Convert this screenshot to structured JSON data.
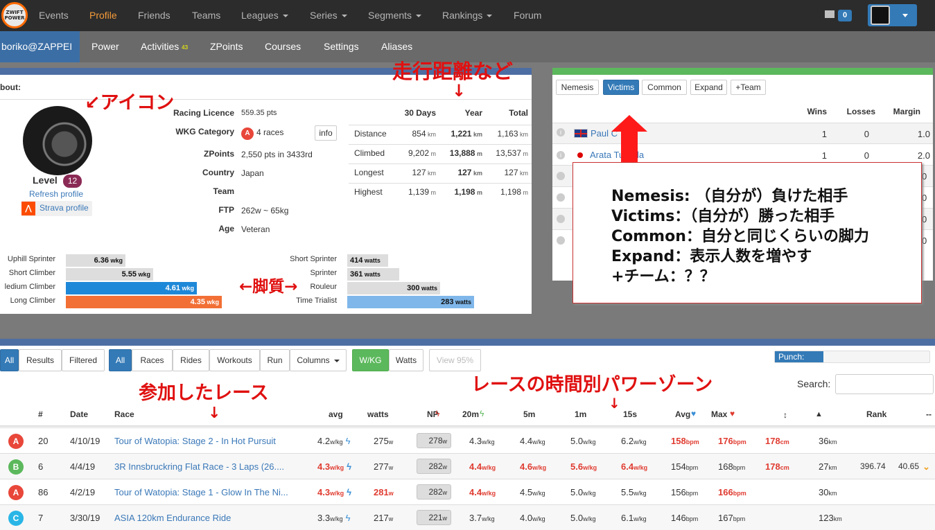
{
  "topnav": {
    "logo": "ZWIFT POWER",
    "items": [
      "Events",
      "Profile",
      "Friends",
      "Teams",
      "Leagues",
      "Series",
      "Segments",
      "Rankings",
      "Forum"
    ],
    "mail_count": "0"
  },
  "subnav": {
    "user": "boriko@ZAPPEI",
    "items": [
      "Power",
      "Activities",
      "ZPoints",
      "Courses",
      "Settings",
      "Aliases"
    ],
    "activities_count": "43"
  },
  "profile": {
    "about": "bout:",
    "level_label": "Level",
    "level": "12",
    "refresh": "Refresh profile",
    "strava": "Strava profile",
    "fields": [
      {
        "label": "Racing Licence",
        "value": "559.35 pts"
      },
      {
        "label": "WKG Category",
        "value": "4 races",
        "badge": "A"
      },
      {
        "label": "ZPoints",
        "value": "2,550 pts in 3433rd"
      },
      {
        "label": "Country",
        "value": "Japan"
      },
      {
        "label": "Team",
        "value": ""
      },
      {
        "label": "FTP",
        "value": "262w ~ 65kg"
      },
      {
        "label": "Age",
        "value": "Veteran"
      }
    ],
    "info_btn": "info"
  },
  "stats": {
    "headers": [
      "30 Days",
      "Year",
      "Total"
    ],
    "rows": [
      {
        "label": "Distance",
        "d30": "854",
        "year": "1,221",
        "total": "1,163",
        "unit": "km"
      },
      {
        "label": "Climbed",
        "d30": "9,202",
        "year": "13,888",
        "total": "13,537",
        "unit": "m"
      },
      {
        "label": "Longest",
        "d30": "127",
        "year": "127",
        "total": "127",
        "unit": "km"
      },
      {
        "label": "Highest",
        "d30": "1,139",
        "year": "1,198",
        "total": "1,198",
        "unit": "m"
      }
    ]
  },
  "strengths_wkg": [
    {
      "label": "Uphill Sprinter",
      "value": "6.36",
      "unit": "wkg",
      "level": 0.38
    },
    {
      "label": "Short Climber",
      "value": "5.55",
      "unit": "wkg",
      "level": 0.56
    },
    {
      "label": "ledium Climber",
      "value": "4.61",
      "unit": "wkg",
      "level": 0.84
    },
    {
      "label": "Long Climber",
      "value": "4.35",
      "unit": "wkg",
      "level": 1.0
    }
  ],
  "strengths_watts": [
    {
      "label": "Short Sprinter",
      "value": "414",
      "unit": "watts",
      "level": 0.32
    },
    {
      "label": "Sprinter",
      "value": "361",
      "unit": "watts",
      "level": 0.41
    },
    {
      "label": "Rouleur",
      "value": "300",
      "unit": "watts",
      "level": 0.73
    },
    {
      "label": "Time Trialist",
      "value": "283",
      "unit": "watts",
      "level": 1.0
    }
  ],
  "rivals": {
    "tabs": [
      "Nemesis",
      "Victims",
      "Common",
      "Expand",
      "+Team"
    ],
    "active": "Victims",
    "headers": [
      "Wins",
      "Losses",
      "Margin"
    ],
    "rows": [
      {
        "name": "Paul C",
        "wins": "1",
        "losses": "0",
        "margin": "1.0"
      },
      {
        "name": "Arata Tunoda",
        "wins": "1",
        "losses": "0",
        "margin": "2.0"
      }
    ],
    "hidden_margins": [
      "0",
      "0",
      "0",
      "0"
    ]
  },
  "annotations": {
    "icon": "↙アイコン",
    "distance": "走行距離など",
    "distance_arrow": "↓",
    "legs": "←脚質→",
    "races": "参加したレース",
    "races_arrow": "↓",
    "zones": "レースの時間別パワーゾーン",
    "zones_arrow": "↓",
    "box": [
      "Nemesis: （自分が）負けた相手",
      "Victims：（自分が）勝った相手",
      "Common：自分と同じくらいの脚力",
      "Expand：表示人数を増やす",
      "+チーム：？？"
    ]
  },
  "filters": {
    "group1": [
      "All",
      "Results",
      "Filtered"
    ],
    "group2": [
      "All",
      "Races",
      "Rides",
      "Workouts",
      "Run",
      "Columns"
    ],
    "group3": [
      "W/KG",
      "Watts"
    ],
    "view": "View 95%",
    "punch": "Punch:",
    "search_label": "Search:"
  },
  "table": {
    "headers": [
      "#",
      "Date",
      "Race",
      "avg",
      "watts",
      "NP",
      "20m",
      "5m",
      "1m",
      "15s",
      "Avg",
      "Max",
      "",
      "",
      "Rank",
      "--"
    ],
    "rows": [
      {
        "cat": "A",
        "color": "#e8473a",
        "pos": "20",
        "date": "4/10/19",
        "race": "Tour of Watopia: Stage 2 - In Hot Pursuit",
        "avg": "4.2",
        "watts": "275",
        "np": "278",
        "m20": "4.3",
        "m5": "4.4",
        "m1": "5.0",
        "s15": "6.2",
        "hr_avg": "158",
        "hr_max": "176",
        "height": "178",
        "dist": "36",
        "rank": "",
        "rank2": ""
      },
      {
        "cat": "B",
        "color": "#5cb85c",
        "pos": "6",
        "date": "4/4/19",
        "race": "3R Innsbruckring Flat Race - 3 Laps (26....",
        "avg": "4.3",
        "watts": "277",
        "np": "282",
        "m20": "4.4",
        "m5": "4.6",
        "m1": "5.6",
        "s15": "6.4",
        "hr_avg": "154",
        "hr_max": "168",
        "height": "178",
        "dist": "27",
        "rank": "396.74",
        "rank2": "40.65"
      },
      {
        "cat": "A",
        "color": "#e8473a",
        "pos": "86",
        "date": "4/2/19",
        "race": "Tour of Watopia: Stage 1 - Glow In The Ni...",
        "avg": "4.3",
        "watts": "281",
        "np": "282",
        "m20": "4.4",
        "m5": "4.5",
        "m1": "5.0",
        "s15": "5.5",
        "hr_avg": "156",
        "hr_max": "166",
        "height": "",
        "dist": "30",
        "rank": "",
        "rank2": ""
      },
      {
        "cat": "C",
        "color": "#29b6e6",
        "pos": "7",
        "date": "3/30/19",
        "race": "ASIA 120km Endurance Ride",
        "avg": "3.3",
        "watts": "217",
        "np": "221",
        "m20": "3.7",
        "m5": "4.0",
        "m1": "5.0",
        "s15": "6.1",
        "hr_avg": "146",
        "hr_max": "167",
        "height": "",
        "dist": "123",
        "rank": "",
        "rank2": ""
      }
    ]
  }
}
